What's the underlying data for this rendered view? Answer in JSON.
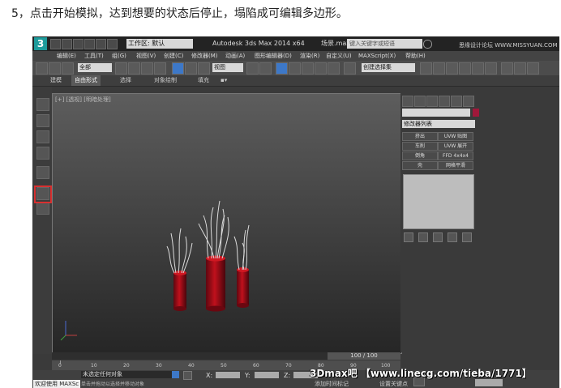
{
  "caption": "5，点击开始模拟，达到想要的状态后停止，塌陷成可编辑多边形。",
  "titlebar": {
    "logo": "3",
    "workspace": "工作区: 默认",
    "app_title": "Autodesk 3ds Max 2014 x64",
    "file_name": "场景.max",
    "search_placeholder": "键入关键字或短语"
  },
  "menus": [
    "编辑(E)",
    "工具(T)",
    "组(G)",
    "视图(V)",
    "创建(C)",
    "修改器(M)",
    "动画(A)",
    "图形编辑器(D)",
    "渲染(R)",
    "自定义(U)",
    "MAXScript(X)",
    "帮助(H)"
  ],
  "toolbar": {
    "selection_filter": "全部",
    "ref_coord": "视图",
    "named_selection": "创建选择集"
  },
  "ribbon_tabs": [
    {
      "label": "建模",
      "active": false
    },
    {
      "label": "自由形式",
      "active": true
    },
    {
      "label": "选择",
      "active": false
    },
    {
      "label": "对象绘制",
      "active": false
    },
    {
      "label": "填充",
      "active": false
    }
  ],
  "viewport": {
    "label": "[+] [透视] [明暗处理]"
  },
  "command_panel": {
    "modifier_list": "修改器列表",
    "object_color": "#a0183a",
    "buttons": [
      "挤出",
      "UVW 贴图",
      "车削",
      "UVW 展开",
      "倒角",
      "FFD 4x4x4",
      "壳",
      "网格平滑"
    ]
  },
  "timeline": {
    "slider_label": "100 / 100",
    "ticks": [
      "0",
      "10",
      "20",
      "30",
      "40",
      "50",
      "60",
      "70",
      "80",
      "90",
      "100"
    ]
  },
  "status": {
    "listener": "欢迎使用 MAXSc",
    "prompt": "未选定任何对象",
    "hint": "单击并拖动以选择并移动对象",
    "coord_labels": [
      "X:",
      "Y:",
      "Z:"
    ],
    "add_tag": "添加时间标记",
    "set_key": "设置关键点"
  },
  "watermark": "3Dmax吧 【www.linecg.com/tieba/1771】",
  "top_watermark": "思缘设计论坛 WWW.MISSYUAN.COM"
}
